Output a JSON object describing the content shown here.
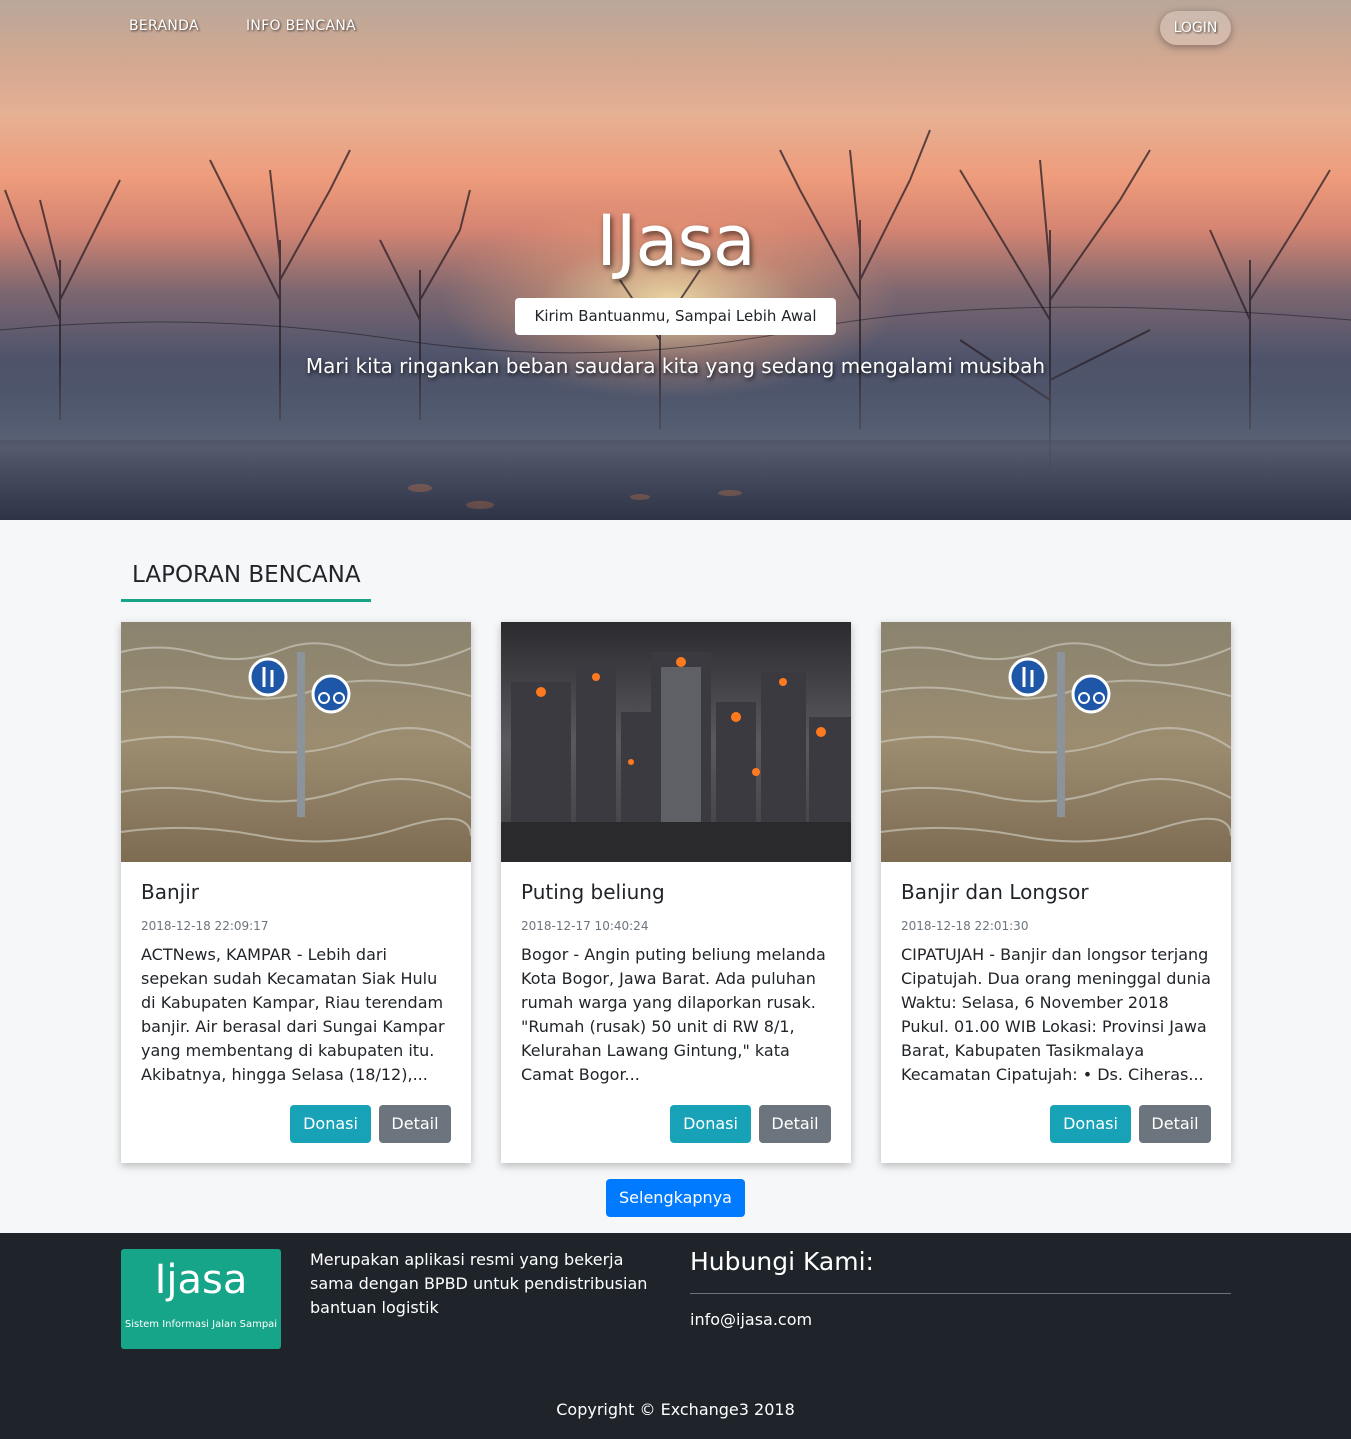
{
  "nav": {
    "links": [
      "BERANDA",
      "INFO BENCANA"
    ],
    "login_label": "LOGIN"
  },
  "hero": {
    "title": "IJasa",
    "tagline": "Kirim Bantuanmu, Sampai Lebih Awal",
    "subtitle": "Mari kita ringankan beban saudara kita yang sedang mengalami musibah"
  },
  "section": {
    "title": "LAPORAN BENCANA"
  },
  "cards": [
    {
      "title": "Banjir",
      "date": "2018-12-18 22:09:17",
      "text": "ACTNews, KAMPAR - Lebih dari sepekan sudah Kecamatan Siak Hulu di Kabupaten Kampar, Riau terendam banjir. Air berasal dari Sungai Kampar yang membentang di kabupaten itu. Akibatnya, hingga Selasa (18/12),...",
      "donate_label": "Donasi",
      "detail_label": "Detail",
      "image": "flood-sign-image"
    },
    {
      "title": "Puting beliung",
      "date": "2018-12-17 10:40:24",
      "text": "Bogor - Angin puting beliung melanda Kota Bogor, Jawa Barat. Ada puluhan rumah warga yang dilaporkan rusak. \"Rumah (rusak) 50 unit di RW 8/1, Kelurahan Lawang Gintung,\" kata Camat Bogor...",
      "donate_label": "Donasi",
      "detail_label": "Detail",
      "image": "burning-city-image"
    },
    {
      "title": "Banjir dan Longsor",
      "date": "2018-12-18 22:01:30",
      "text": "CIPATUJAH - Banjir dan longsor terjang Cipatujah. Dua orang meninggal dunia Waktu: Selasa, 6 November 2018 Pukul. 01.00 WIB Lokasi: Provinsi Jawa Barat, Kabupaten Tasikmalaya Kecamatan Cipatujah: • Ds. Ciheras...",
      "donate_label": "Donasi",
      "detail_label": "Detail",
      "image": "flood-sign-image"
    }
  ],
  "more_label": "Selengkapnya",
  "footer": {
    "logo_name": "Ijasa",
    "logo_sub": "Sistem Informasi Jalan Sampai",
    "description": "Merupakan aplikasi resmi yang bekerja sama dengan BPBD untuk pendistribusian bantuan logistik",
    "contact_title": "Hubungi Kami:",
    "email": "info@ijasa.com",
    "copyright": "Copyright © Exchange3 2018"
  },
  "colors": {
    "accent": "#17a589",
    "donate": "#17a2b8",
    "detail": "#6c757d",
    "primary": "#007bff",
    "footer_bg": "#1f242b"
  }
}
